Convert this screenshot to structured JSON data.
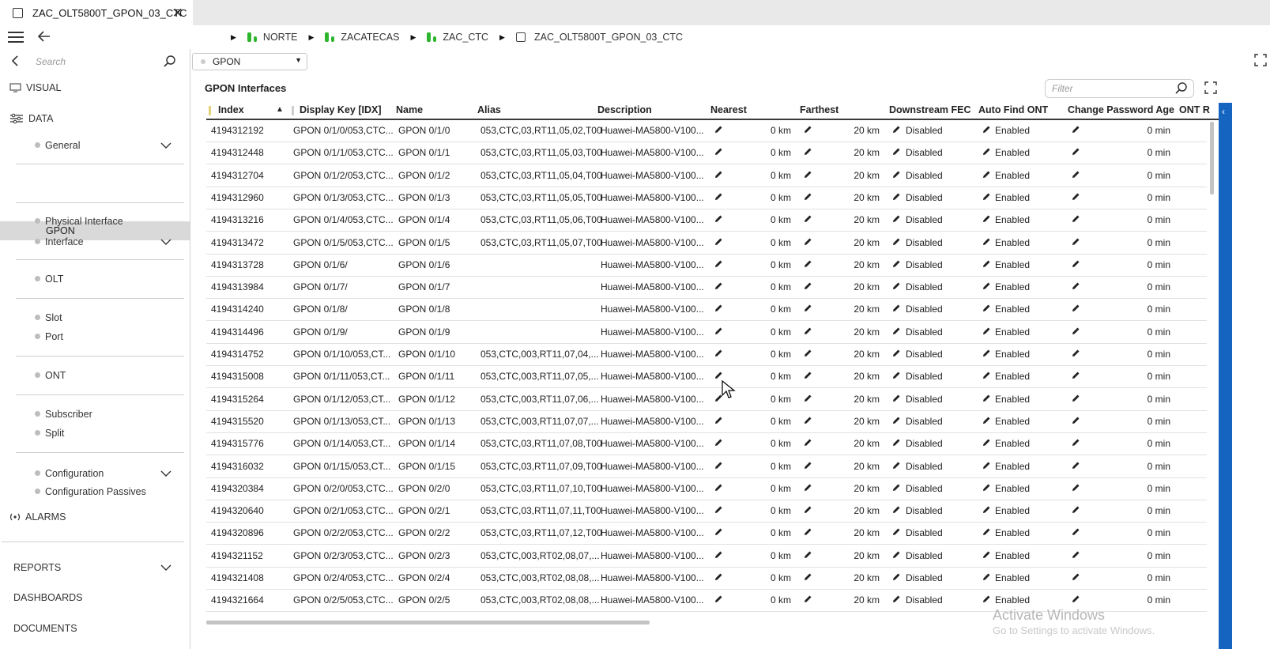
{
  "tab": {
    "title": "ZAC_OLT5800T_GPON_03_CTC",
    "close_glyph": "✕"
  },
  "breadcrumb": {
    "items": [
      {
        "label": "NORTE",
        "icon": "green-status-icon"
      },
      {
        "label": "ZACATECAS",
        "icon": "green-status-icon"
      },
      {
        "label": "ZAC_CTC",
        "icon": "green-status-icon"
      },
      {
        "label": "ZAC_OLT5800T_GPON_03_CTC",
        "icon": "device-icon"
      }
    ]
  },
  "sidebar": {
    "search_placeholder": "Search",
    "visual": "VISUAL",
    "data": "DATA",
    "items": {
      "general": "General",
      "gpon": "GPON",
      "physical_interface": "Physical Interface",
      "interface": "Interface",
      "olt": "OLT",
      "slot": "Slot",
      "port": "Port",
      "ont": "ONT",
      "subscriber": "Subscriber",
      "split": "Split",
      "configuration": "Configuration",
      "configuration_passives": "Configuration Passives"
    },
    "alarms": "ALARMS",
    "reports": "REPORTS",
    "dashboards": "DASHBOARDS",
    "documents": "DOCUMENTS"
  },
  "main": {
    "dropdown_value": "GPON",
    "section_title": "GPON Interfaces",
    "filter_placeholder": "Filter",
    "columns": {
      "index": "Index",
      "display_key": "Display Key [IDX]",
      "name": "Name",
      "alias": "Alias",
      "description": "Description",
      "nearest": "Nearest",
      "farthest": "Farthest",
      "downstream_fec": "Downstream FEC",
      "auto_find_ont": "Auto Find ONT",
      "change_password_age": "Change Password Age",
      "ont_r": "ONT R"
    },
    "rows": [
      {
        "index": "4194312192",
        "key": "GPON 0/1/0/053,CTC...",
        "name": "GPON 0/1/0",
        "alias": "053,CTC,03,RT11,05,02,T00",
        "desc": "Huawei-MA5800-V100...",
        "nearest": "0 km",
        "farthest": "20 km",
        "fec": "Disabled",
        "auto": "Enabled",
        "age": "0 min"
      },
      {
        "index": "4194312448",
        "key": "GPON 0/1/1/053,CTC...",
        "name": "GPON 0/1/1",
        "alias": "053,CTC,03,RT11,05,03,T00",
        "desc": "Huawei-MA5800-V100...",
        "nearest": "0 km",
        "farthest": "20 km",
        "fec": "Disabled",
        "auto": "Enabled",
        "age": "0 min"
      },
      {
        "index": "4194312704",
        "key": "GPON 0/1/2/053,CTC...",
        "name": "GPON 0/1/2",
        "alias": "053,CTC,03,RT11,05,04,T00",
        "desc": "Huawei-MA5800-V100...",
        "nearest": "0 km",
        "farthest": "20 km",
        "fec": "Disabled",
        "auto": "Enabled",
        "age": "0 min"
      },
      {
        "index": "4194312960",
        "key": "GPON 0/1/3/053,CTC...",
        "name": "GPON 0/1/3",
        "alias": "053,CTC,03,RT11,05,05,T00",
        "desc": "Huawei-MA5800-V100...",
        "nearest": "0 km",
        "farthest": "20 km",
        "fec": "Disabled",
        "auto": "Enabled",
        "age": "0 min"
      },
      {
        "index": "4194313216",
        "key": "GPON 0/1/4/053,CTC...",
        "name": "GPON 0/1/4",
        "alias": "053,CTC,03,RT11,05,06,T00",
        "desc": "Huawei-MA5800-V100...",
        "nearest": "0 km",
        "farthest": "20 km",
        "fec": "Disabled",
        "auto": "Enabled",
        "age": "0 min"
      },
      {
        "index": "4194313472",
        "key": "GPON 0/1/5/053,CTC...",
        "name": "GPON 0/1/5",
        "alias": "053,CTC,03,RT11,05,07,T00",
        "desc": "Huawei-MA5800-V100...",
        "nearest": "0 km",
        "farthest": "20 km",
        "fec": "Disabled",
        "auto": "Enabled",
        "age": "0 min"
      },
      {
        "index": "4194313728",
        "key": "GPON 0/1/6/",
        "name": "GPON 0/1/6",
        "alias": "",
        "desc": "Huawei-MA5800-V100...",
        "nearest": "0 km",
        "farthest": "20 km",
        "fec": "Disabled",
        "auto": "Enabled",
        "age": "0 min"
      },
      {
        "index": "4194313984",
        "key": "GPON 0/1/7/",
        "name": "GPON 0/1/7",
        "alias": "",
        "desc": "Huawei-MA5800-V100...",
        "nearest": "0 km",
        "farthest": "20 km",
        "fec": "Disabled",
        "auto": "Enabled",
        "age": "0 min"
      },
      {
        "index": "4194314240",
        "key": "GPON 0/1/8/",
        "name": "GPON 0/1/8",
        "alias": "",
        "desc": "Huawei-MA5800-V100...",
        "nearest": "0 km",
        "farthest": "20 km",
        "fec": "Disabled",
        "auto": "Enabled",
        "age": "0 min"
      },
      {
        "index": "4194314496",
        "key": "GPON 0/1/9/",
        "name": "GPON 0/1/9",
        "alias": "",
        "desc": "Huawei-MA5800-V100...",
        "nearest": "0 km",
        "farthest": "20 km",
        "fec": "Disabled",
        "auto": "Enabled",
        "age": "0 min"
      },
      {
        "index": "4194314752",
        "key": "GPON 0/1/10/053,CT...",
        "name": "GPON 0/1/10",
        "alias": "053,CTC,003,RT11,07,04,...",
        "desc": "Huawei-MA5800-V100...",
        "nearest": "0 km",
        "farthest": "20 km",
        "fec": "Disabled",
        "auto": "Enabled",
        "age": "0 min"
      },
      {
        "index": "4194315008",
        "key": "GPON 0/1/11/053,CT...",
        "name": "GPON 0/1/11",
        "alias": "053,CTC,003,RT11,07,05,...",
        "desc": "Huawei-MA5800-V100...",
        "nearest": "0 km",
        "farthest": "20 km",
        "fec": "Disabled",
        "auto": "Enabled",
        "age": "0 min"
      },
      {
        "index": "4194315264",
        "key": "GPON 0/1/12/053,CT...",
        "name": "GPON 0/1/12",
        "alias": "053,CTC,003,RT11,07,06,...",
        "desc": "Huawei-MA5800-V100...",
        "nearest": "0 km",
        "farthest": "20 km",
        "fec": "Disabled",
        "auto": "Enabled",
        "age": "0 min"
      },
      {
        "index": "4194315520",
        "key": "GPON 0/1/13/053,CT...",
        "name": "GPON 0/1/13",
        "alias": "053,CTC,003,RT11,07,07,...",
        "desc": "Huawei-MA5800-V100...",
        "nearest": "0 km",
        "farthest": "20 km",
        "fec": "Disabled",
        "auto": "Enabled",
        "age": "0 min"
      },
      {
        "index": "4194315776",
        "key": "GPON 0/1/14/053,CT...",
        "name": "GPON 0/1/14",
        "alias": "053,CTC,03,RT11,07,08,T00",
        "desc": "Huawei-MA5800-V100...",
        "nearest": "0 km",
        "farthest": "20 km",
        "fec": "Disabled",
        "auto": "Enabled",
        "age": "0 min"
      },
      {
        "index": "4194316032",
        "key": "GPON 0/1/15/053,CT...",
        "name": "GPON 0/1/15",
        "alias": "053,CTC,03,RT11,07,09,T00",
        "desc": "Huawei-MA5800-V100...",
        "nearest": "0 km",
        "farthest": "20 km",
        "fec": "Disabled",
        "auto": "Enabled",
        "age": "0 min"
      },
      {
        "index": "4194320384",
        "key": "GPON 0/2/0/053,CTC...",
        "name": "GPON 0/2/0",
        "alias": "053,CTC,03,RT11,07,10,T00",
        "desc": "Huawei-MA5800-V100...",
        "nearest": "0 km",
        "farthest": "20 km",
        "fec": "Disabled",
        "auto": "Enabled",
        "age": "0 min"
      },
      {
        "index": "4194320640",
        "key": "GPON 0/2/1/053,CTC...",
        "name": "GPON 0/2/1",
        "alias": "053,CTC,03,RT11,07,11,T00",
        "desc": "Huawei-MA5800-V100...",
        "nearest": "0 km",
        "farthest": "20 km",
        "fec": "Disabled",
        "auto": "Enabled",
        "age": "0 min"
      },
      {
        "index": "4194320896",
        "key": "GPON 0/2/2/053,CTC...",
        "name": "GPON 0/2/2",
        "alias": "053,CTC,03,RT11,07,12,T00",
        "desc": "Huawei-MA5800-V100...",
        "nearest": "0 km",
        "farthest": "20 km",
        "fec": "Disabled",
        "auto": "Enabled",
        "age": "0 min"
      },
      {
        "index": "4194321152",
        "key": "GPON 0/2/3/053,CTC...",
        "name": "GPON 0/2/3",
        "alias": "053,CTC,003,RT02,08,07,...",
        "desc": "Huawei-MA5800-V100...",
        "nearest": "0 km",
        "farthest": "20 km",
        "fec": "Disabled",
        "auto": "Enabled",
        "age": "0 min"
      },
      {
        "index": "4194321408",
        "key": "GPON 0/2/4/053,CTC...",
        "name": "GPON 0/2/4",
        "alias": "053,CTC,003,RT02,08,08,...",
        "desc": "Huawei-MA5800-V100...",
        "nearest": "0 km",
        "farthest": "20 km",
        "fec": "Disabled",
        "auto": "Enabled",
        "age": "0 min"
      },
      {
        "index": "4194321664",
        "key": "GPON 0/2/5/053,CTC...",
        "name": "GPON 0/2/5",
        "alias": "053,CTC,003,RT02,08,08,...",
        "desc": "Huawei-MA5800-V100...",
        "nearest": "0 km",
        "farthest": "20 km",
        "fec": "Disabled",
        "auto": "Enabled",
        "age": "0 min"
      }
    ]
  },
  "watermark": {
    "line1": "Activate Windows",
    "line2": "Go to Settings to activate Windows."
  },
  "colors": {
    "accent": "#1565c0",
    "status_green": "#2db52d",
    "selected_bg": "#d9d9d9"
  }
}
